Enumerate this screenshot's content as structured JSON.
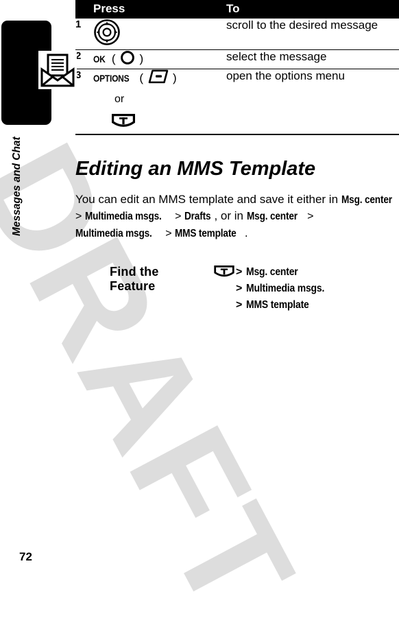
{
  "sidebar": {
    "chapter_label": "Messages and Chat",
    "chapter_icon": "envelope-icon",
    "page_number": "72"
  },
  "watermark": {
    "text": "DRAFT",
    "color": "#dddddd"
  },
  "press_table": {
    "headers": {
      "num": "",
      "press": "Press",
      "to": "To"
    },
    "rows": [
      {
        "num": "1",
        "press_label": "",
        "press_icon": "navigation-key-icon",
        "to": "scroll to the desired message"
      },
      {
        "num": "2",
        "press_label": "OK",
        "press_icon": "center-select-key-icon",
        "to": "select the message"
      },
      {
        "num": "3",
        "press_label": "OPTIONS",
        "press_icon": "soft-key-icon",
        "or_label": "or",
        "alt_icon": "menu-key-icon",
        "to": "open the options menu"
      }
    ]
  },
  "section": {
    "title": "Editing an MMS Template",
    "body": {
      "part1": "You can edit an MMS template and save it either in ",
      "ref1": "Msg. center",
      "sep1": " > ",
      "ref2": "Multimedia msgs.",
      "sep2": " > ",
      "ref3": "Drafts",
      "part2": ", or in ",
      "ref4": "Msg. center",
      "sep3": " > ",
      "ref5": "Multimedia msgs.",
      "sep4": " > ",
      "ref6": "MMS template",
      "part3": "."
    }
  },
  "find_feature": {
    "label": "Find the Feature",
    "icon": "menu-key-icon",
    "path": [
      {
        "arrow": ">",
        "item": "Msg. center"
      },
      {
        "arrow": ">",
        "item": "Multimedia msgs."
      },
      {
        "arrow": ">",
        "item": "MMS template"
      }
    ]
  }
}
